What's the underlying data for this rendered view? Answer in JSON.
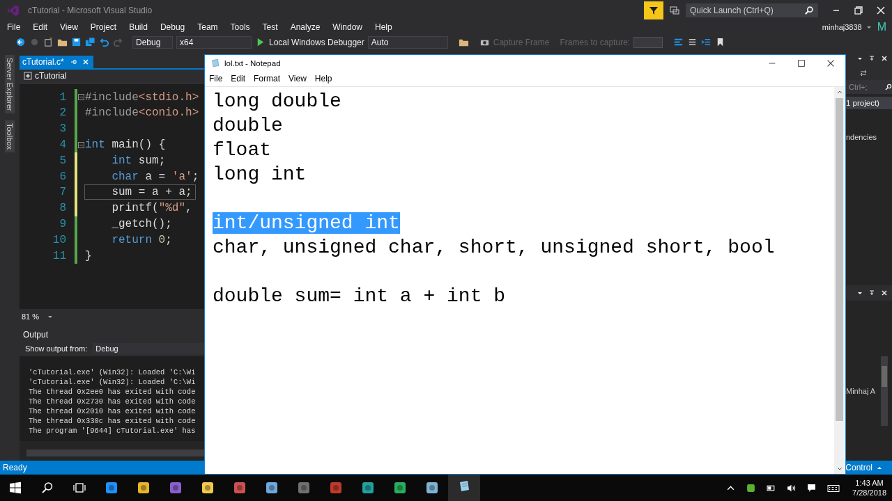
{
  "vs": {
    "title": "cTutorial - Microsoft Visual Studio",
    "quick_launch": {
      "placeholder": "Quick Launch (Ctrl+Q)"
    },
    "menu": [
      "File",
      "Edit",
      "View",
      "Project",
      "Build",
      "Debug",
      "Team",
      "Tools",
      "Test",
      "Analyze",
      "Window",
      "Help"
    ],
    "user": "minhaj3838",
    "avatar": "M",
    "toolbar": {
      "configuration": "Debug",
      "platform": "x64",
      "debugger": "Local Windows Debugger",
      "target": "Auto",
      "capture": "Capture Frame",
      "frames_label": "Frames to capture:"
    },
    "side_tabs": [
      "Server Explorer",
      "Toolbox"
    ],
    "editor": {
      "tab": {
        "label": "cTutorial.c*",
        "selected": true
      },
      "scope": "cTutorial",
      "zoom": "81 %",
      "lines": [
        {
          "number": "1",
          "fold": true,
          "current": false,
          "color": "#57a64a",
          "tokens": [
            {
              "kind": "preproc",
              "text": "#include"
            },
            {
              "kind": "string",
              "text": "<stdio.h>"
            }
          ]
        },
        {
          "number": "2",
          "fold": false,
          "current": false,
          "color": "#57a64a",
          "tokens": [
            {
              "kind": "preproc",
              "text": "#include"
            },
            {
              "kind": "string",
              "text": "<conio.h>"
            }
          ]
        },
        {
          "number": "3",
          "fold": false,
          "current": false,
          "color": "#57a64a"
        },
        {
          "number": "4",
          "fold": true,
          "current": false,
          "color": "#57a64a",
          "tokens": [
            {
              "kind": "keyword",
              "text": "int"
            },
            {
              "kind": "text",
              "text": " main() {"
            }
          ]
        },
        {
          "number": "5",
          "fold": false,
          "current": false,
          "color": "#e5e57c",
          "tokens": [
            {
              "kind": "keyword",
              "text": "    int"
            },
            {
              "kind": "text",
              "text": " sum;"
            }
          ]
        },
        {
          "number": "6",
          "fold": false,
          "current": false,
          "color": "#e5e57c",
          "tokens": [
            {
              "kind": "keyword",
              "text": "    char"
            },
            {
              "kind": "text",
              "text": " a = "
            },
            {
              "kind": "string",
              "text": "'a'"
            },
            {
              "kind": "text",
              "text": ";"
            }
          ]
        },
        {
          "number": "7",
          "fold": false,
          "current": true,
          "color": "#e5e57c",
          "tokens": [
            {
              "kind": "text",
              "text": "    sum = a + a;"
            }
          ]
        },
        {
          "number": "8",
          "fold": false,
          "current": false,
          "color": "#e5e57c",
          "tokens": [
            {
              "kind": "text",
              "text": "    printf("
            },
            {
              "kind": "string",
              "text": "\"%d\""
            },
            {
              "kind": "text",
              "text": ","
            }
          ]
        },
        {
          "number": "9",
          "fold": false,
          "current": false,
          "color": "#57a64a",
          "tokens": [
            {
              "kind": "text",
              "text": "    _getch();"
            }
          ]
        },
        {
          "number": "10",
          "fold": false,
          "current": false,
          "color": "#57a64a",
          "tokens": [
            {
              "kind": "keyword",
              "text": "    return"
            },
            {
              "kind": "number",
              "text": " 0"
            },
            {
              "kind": "text",
              "text": ";"
            }
          ]
        },
        {
          "number": "11",
          "fold": false,
          "current": false,
          "color": "#57a64a",
          "tokens": [
            {
              "kind": "text",
              "text": "}"
            }
          ]
        }
      ]
    },
    "output": {
      "title": "Output",
      "source_label": "Show output from:",
      "source": "Debug",
      "lines": [
        "'cTutorial.exe' (Win32): Loaded 'C:\\Wi",
        "'cTutorial.exe' (Win32): Loaded 'C:\\Wi",
        "The thread 0x2ee0 has exited with code",
        "The thread 0x2730 has exited with code",
        "The thread 0x2010 has exited with code",
        "The thread 0x330c has exited with code",
        "The program '[9644] cTutorial.exe' has"
      ]
    },
    "right_panel": {
      "search": "Ctrl+;",
      "selected_row": "1 project)",
      "row": "ndencies",
      "lower_row": "Minhaj A"
    },
    "status": {
      "left": "Ready",
      "right": "Control"
    }
  },
  "notepad": {
    "title": "lol.txt - Notepad",
    "menu": [
      "File",
      "Edit",
      "Format",
      "View",
      "Help"
    ],
    "paragraphs": [
      [
        {
          "text": "long double",
          "selected": false
        },
        {
          "text": "double",
          "selected": false
        },
        {
          "text": "float",
          "selected": false
        },
        {
          "text": "long int",
          "selected": false
        }
      ],
      [
        {
          "text": "int/unsigned int",
          "selected": true
        },
        {
          "text": "char, unsigned char, short, unsigned short, bool",
          "selected": false
        }
      ],
      [
        {
          "text": "double sum= int a + int b",
          "selected": false
        }
      ]
    ]
  },
  "taskbar": {
    "time": "1:43 AM",
    "date": "7/28/2018"
  }
}
